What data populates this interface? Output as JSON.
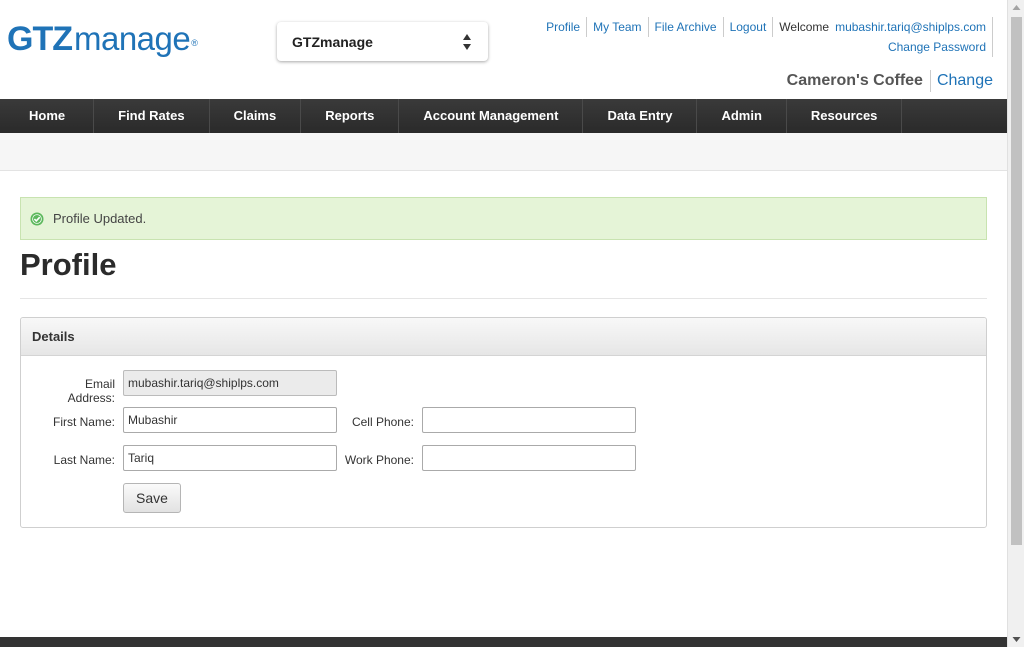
{
  "brand": {
    "logo_bold": "GTZ",
    "logo_regular": "manage",
    "logo_mark": "®"
  },
  "company_selector": {
    "selected": "GTZmanage",
    "icon": "sort-arrows-icon"
  },
  "top_links": {
    "profile": "Profile",
    "my_team": "My Team",
    "file_archive": "File Archive",
    "logout": "Logout",
    "welcome": "Welcome",
    "user_email": "mubashir.tariq@shiplps.com",
    "change_password": "Change Password"
  },
  "account": {
    "company_name": "Cameron's Coffee",
    "change_label": "Change"
  },
  "nav": {
    "items": [
      "Home",
      "Find Rates",
      "Claims",
      "Reports",
      "Account Management",
      "Data Entry",
      "Admin",
      "Resources"
    ]
  },
  "alert": {
    "message": "Profile Updated.",
    "icon": "check-circle-icon",
    "color": "#e5f4d7"
  },
  "page": {
    "title": "Profile"
  },
  "details": {
    "heading": "Details",
    "email_label": "Email Address:",
    "email_value": "mubashir.tariq@shiplps.com",
    "first_name_label": "First Name:",
    "first_name_value": "Mubashir",
    "last_name_label": "Last Name:",
    "last_name_value": "Tariq",
    "cell_phone_label": "Cell Phone:",
    "cell_phone_value": "",
    "work_phone_label": "Work Phone:",
    "work_phone_value": "",
    "save_label": "Save"
  },
  "colors": {
    "brand_blue": "#1f73b7",
    "nav_bg": "#2f2f2f"
  }
}
